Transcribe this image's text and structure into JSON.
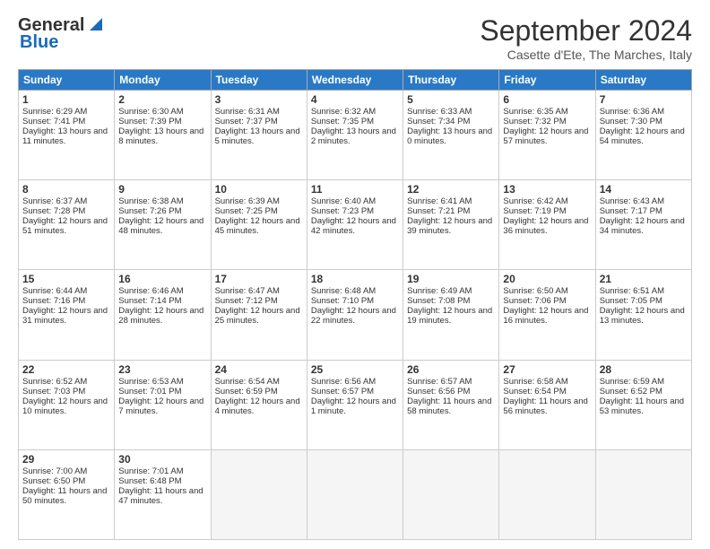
{
  "header": {
    "logo_line1": "General",
    "logo_line2": "Blue",
    "month": "September 2024",
    "location": "Casette d'Ete, The Marches, Italy"
  },
  "days_of_week": [
    "Sunday",
    "Monday",
    "Tuesday",
    "Wednesday",
    "Thursday",
    "Friday",
    "Saturday"
  ],
  "weeks": [
    [
      {
        "day": "1",
        "data": "Sunrise: 6:29 AM\nSunset: 7:41 PM\nDaylight: 13 hours and 11 minutes."
      },
      {
        "day": "2",
        "data": "Sunrise: 6:30 AM\nSunset: 7:39 PM\nDaylight: 13 hours and 8 minutes."
      },
      {
        "day": "3",
        "data": "Sunrise: 6:31 AM\nSunset: 7:37 PM\nDaylight: 13 hours and 5 minutes."
      },
      {
        "day": "4",
        "data": "Sunrise: 6:32 AM\nSunset: 7:35 PM\nDaylight: 13 hours and 2 minutes."
      },
      {
        "day": "5",
        "data": "Sunrise: 6:33 AM\nSunset: 7:34 PM\nDaylight: 13 hours and 0 minutes."
      },
      {
        "day": "6",
        "data": "Sunrise: 6:35 AM\nSunset: 7:32 PM\nDaylight: 12 hours and 57 minutes."
      },
      {
        "day": "7",
        "data": "Sunrise: 6:36 AM\nSunset: 7:30 PM\nDaylight: 12 hours and 54 minutes."
      }
    ],
    [
      {
        "day": "8",
        "data": "Sunrise: 6:37 AM\nSunset: 7:28 PM\nDaylight: 12 hours and 51 minutes."
      },
      {
        "day": "9",
        "data": "Sunrise: 6:38 AM\nSunset: 7:26 PM\nDaylight: 12 hours and 48 minutes."
      },
      {
        "day": "10",
        "data": "Sunrise: 6:39 AM\nSunset: 7:25 PM\nDaylight: 12 hours and 45 minutes."
      },
      {
        "day": "11",
        "data": "Sunrise: 6:40 AM\nSunset: 7:23 PM\nDaylight: 12 hours and 42 minutes."
      },
      {
        "day": "12",
        "data": "Sunrise: 6:41 AM\nSunset: 7:21 PM\nDaylight: 12 hours and 39 minutes."
      },
      {
        "day": "13",
        "data": "Sunrise: 6:42 AM\nSunset: 7:19 PM\nDaylight: 12 hours and 36 minutes."
      },
      {
        "day": "14",
        "data": "Sunrise: 6:43 AM\nSunset: 7:17 PM\nDaylight: 12 hours and 34 minutes."
      }
    ],
    [
      {
        "day": "15",
        "data": "Sunrise: 6:44 AM\nSunset: 7:16 PM\nDaylight: 12 hours and 31 minutes."
      },
      {
        "day": "16",
        "data": "Sunrise: 6:46 AM\nSunset: 7:14 PM\nDaylight: 12 hours and 28 minutes."
      },
      {
        "day": "17",
        "data": "Sunrise: 6:47 AM\nSunset: 7:12 PM\nDaylight: 12 hours and 25 minutes."
      },
      {
        "day": "18",
        "data": "Sunrise: 6:48 AM\nSunset: 7:10 PM\nDaylight: 12 hours and 22 minutes."
      },
      {
        "day": "19",
        "data": "Sunrise: 6:49 AM\nSunset: 7:08 PM\nDaylight: 12 hours and 19 minutes."
      },
      {
        "day": "20",
        "data": "Sunrise: 6:50 AM\nSunset: 7:06 PM\nDaylight: 12 hours and 16 minutes."
      },
      {
        "day": "21",
        "data": "Sunrise: 6:51 AM\nSunset: 7:05 PM\nDaylight: 12 hours and 13 minutes."
      }
    ],
    [
      {
        "day": "22",
        "data": "Sunrise: 6:52 AM\nSunset: 7:03 PM\nDaylight: 12 hours and 10 minutes."
      },
      {
        "day": "23",
        "data": "Sunrise: 6:53 AM\nSunset: 7:01 PM\nDaylight: 12 hours and 7 minutes."
      },
      {
        "day": "24",
        "data": "Sunrise: 6:54 AM\nSunset: 6:59 PM\nDaylight: 12 hours and 4 minutes."
      },
      {
        "day": "25",
        "data": "Sunrise: 6:56 AM\nSunset: 6:57 PM\nDaylight: 12 hours and 1 minute."
      },
      {
        "day": "26",
        "data": "Sunrise: 6:57 AM\nSunset: 6:56 PM\nDaylight: 11 hours and 58 minutes."
      },
      {
        "day": "27",
        "data": "Sunrise: 6:58 AM\nSunset: 6:54 PM\nDaylight: 11 hours and 56 minutes."
      },
      {
        "day": "28",
        "data": "Sunrise: 6:59 AM\nSunset: 6:52 PM\nDaylight: 11 hours and 53 minutes."
      }
    ],
    [
      {
        "day": "29",
        "data": "Sunrise: 7:00 AM\nSunset: 6:50 PM\nDaylight: 11 hours and 50 minutes."
      },
      {
        "day": "30",
        "data": "Sunrise: 7:01 AM\nSunset: 6:48 PM\nDaylight: 11 hours and 47 minutes."
      },
      {
        "day": "",
        "data": ""
      },
      {
        "day": "",
        "data": ""
      },
      {
        "day": "",
        "data": ""
      },
      {
        "day": "",
        "data": ""
      },
      {
        "day": "",
        "data": ""
      }
    ]
  ]
}
